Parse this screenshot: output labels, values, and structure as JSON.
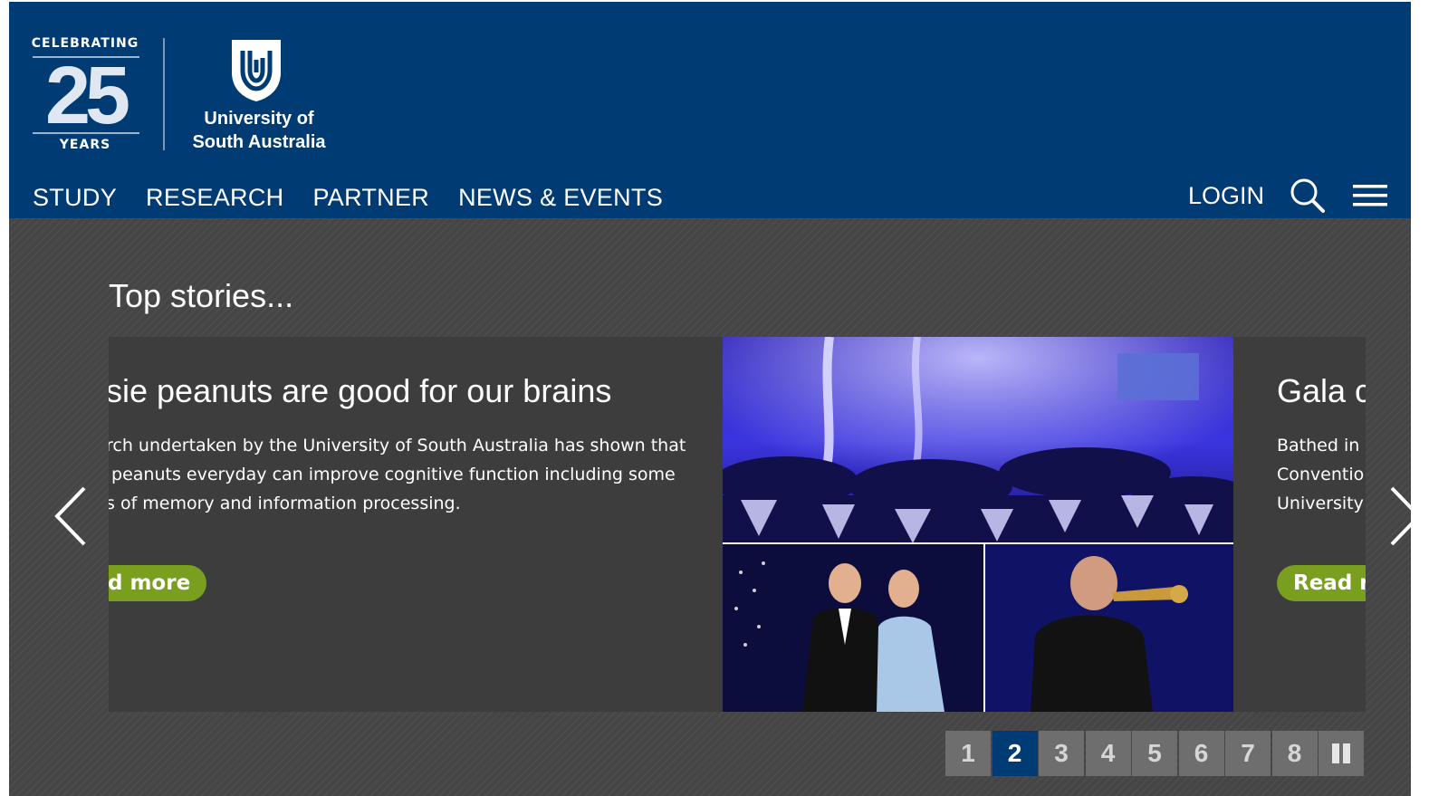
{
  "header": {
    "badge": {
      "top": "CELEBRATING",
      "number": "25",
      "bottom": "YEARS"
    },
    "university_name_line1": "University of",
    "university_name_line2": "South Australia",
    "nav": [
      {
        "label": "STUDY"
      },
      {
        "label": "RESEARCH"
      },
      {
        "label": "PARTNER"
      },
      {
        "label": "NEWS & EVENTS"
      }
    ],
    "login_label": "LOGIN",
    "icons": {
      "search": "search-icon",
      "menu": "hamburger-menu-icon"
    }
  },
  "stories": {
    "title": "Top stories...",
    "current_slide": {
      "headline": "sie peanuts are good for our brains",
      "body": "rch undertaken by the University of South Australia has shown that peanuts everyday can improve cognitive function including some s of memory and information processing.",
      "body_lines": [
        "rch undertaken by the University of South Australia has shown that",
        " peanuts everyday can improve cognitive function including some",
        "s of memory and information processing."
      ],
      "read_more": "d more",
      "image": "gala dinner collage: banquet hall with blue lighting, couple in formal wear, trumpet player"
    },
    "next_slide": {
      "headline": "Gala c",
      "body_lines": [
        "Bathed in",
        "Conventio",
        "University"
      ],
      "read_more": "Read r"
    },
    "pager": {
      "pages": [
        "1",
        "2",
        "3",
        "4",
        "5",
        "6",
        "7",
        "8"
      ],
      "active": "2"
    },
    "icons": {
      "prev": "chevron-left-icon",
      "next": "chevron-right-icon",
      "pause": "pause-icon"
    }
  },
  "colors": {
    "header_bg": "#003b73",
    "stories_bg": "#454545",
    "button_green": "#7a9e1d",
    "pager_active": "#003b73"
  }
}
